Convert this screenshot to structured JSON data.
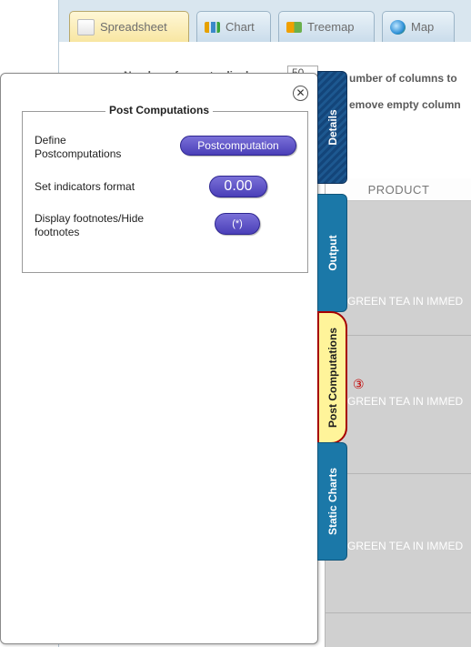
{
  "tabs": [
    {
      "label": "Spreadsheet",
      "active": true,
      "icon": "spreadsheet-icon"
    },
    {
      "label": "Chart",
      "active": false,
      "icon": "chart-icon"
    },
    {
      "label": "Treemap",
      "active": false,
      "icon": "treemap-icon"
    },
    {
      "label": "Map",
      "active": false,
      "icon": "globe-icon"
    }
  ],
  "options": {
    "rows_label": "Number of rows to display",
    "rows_value": "50",
    "columns_label": "umber of columns to",
    "remove_empty_label": "emove empty column"
  },
  "grid": {
    "column_header": "PRODUCT",
    "cells": [
      "GREEN TEA IN IMMED",
      "GREEN TEA IN IMMED",
      "GREEN TEA IN IMMED"
    ]
  },
  "side_tabs": [
    "Details",
    "Output",
    "Post Computations",
    "Static Charts"
  ],
  "annotation": "③",
  "panel": {
    "close_symbol": "✕",
    "group_title": "Post Computations",
    "rows": [
      {
        "label": "Define Postcomputations",
        "button": "Postcomputation"
      },
      {
        "label": "Set indicators format",
        "button": "0.00"
      },
      {
        "label": "Display footnotes/Hide footnotes",
        "button": "(*)"
      }
    ]
  },
  "colors": {
    "side_tab": "#1b78a8",
    "side_tab_highlight": "#fff49a",
    "pill_button": "#5a4fc8",
    "annotation": "#c10000"
  }
}
